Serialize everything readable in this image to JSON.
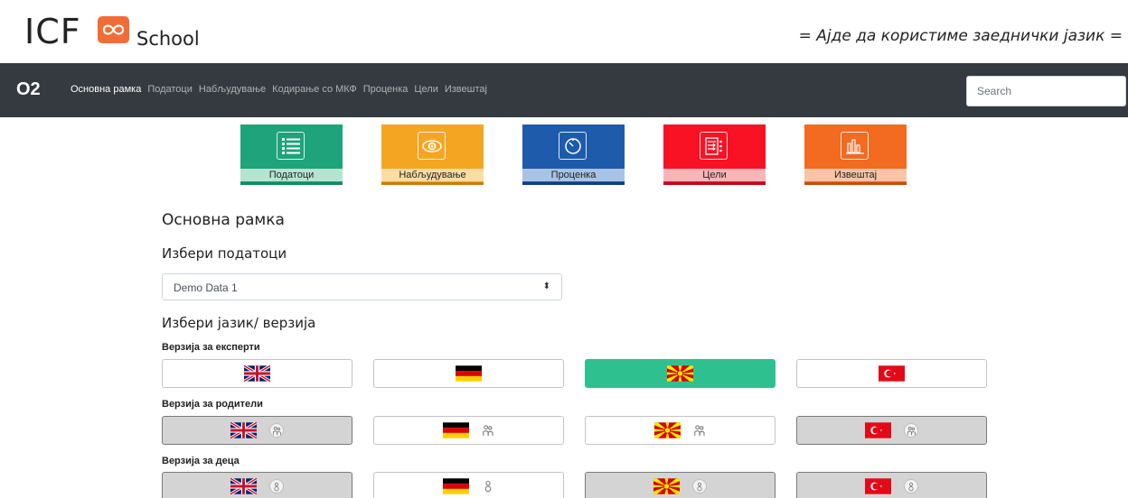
{
  "header": {
    "logo_text": "ICF",
    "logo_sub": "School",
    "tagline": "= Ајде да користиме заеднички јазик ="
  },
  "navbar": {
    "brand": "O2",
    "links": [
      "Основна рамка",
      "Податоци",
      "Набљудување",
      "Кодирање со МКФ",
      "Проценка",
      "Цели",
      "Извештај"
    ],
    "search_placeholder": "Search"
  },
  "tiles": [
    {
      "label": "Податоци",
      "color": "#1ea37b",
      "bar": "#138a62",
      "icon": "list-icon"
    },
    {
      "label": "Набљудување",
      "color": "#f4a623",
      "bar": "#c97c0c",
      "icon": "eye-icon"
    },
    {
      "label": "Проценка",
      "color": "#1e5cab",
      "bar": "#0f3f80",
      "icon": "gauge-icon"
    },
    {
      "label": "Цели",
      "color": "#f81224",
      "bar": "#c00a18",
      "icon": "goals-icon"
    },
    {
      "label": "Извештај",
      "color": "#f36a21",
      "bar": "#c54e11",
      "icon": "report-icon"
    }
  ],
  "main": {
    "title": "Основна рамка",
    "data_title": "Избери податоци",
    "selected_data": "Demo Data 1",
    "lang_title": "Избери јазик/ верзија"
  },
  "versions": [
    {
      "label": "Верзија за експерти"
    },
    {
      "label": "Верзија за родители"
    },
    {
      "label": "Верзија за деца"
    }
  ],
  "colors": {
    "navbar": "#343a40",
    "selected": "#2ec18f",
    "disabled": "#d4d4d4",
    "logo_badge": "#f26c35"
  }
}
